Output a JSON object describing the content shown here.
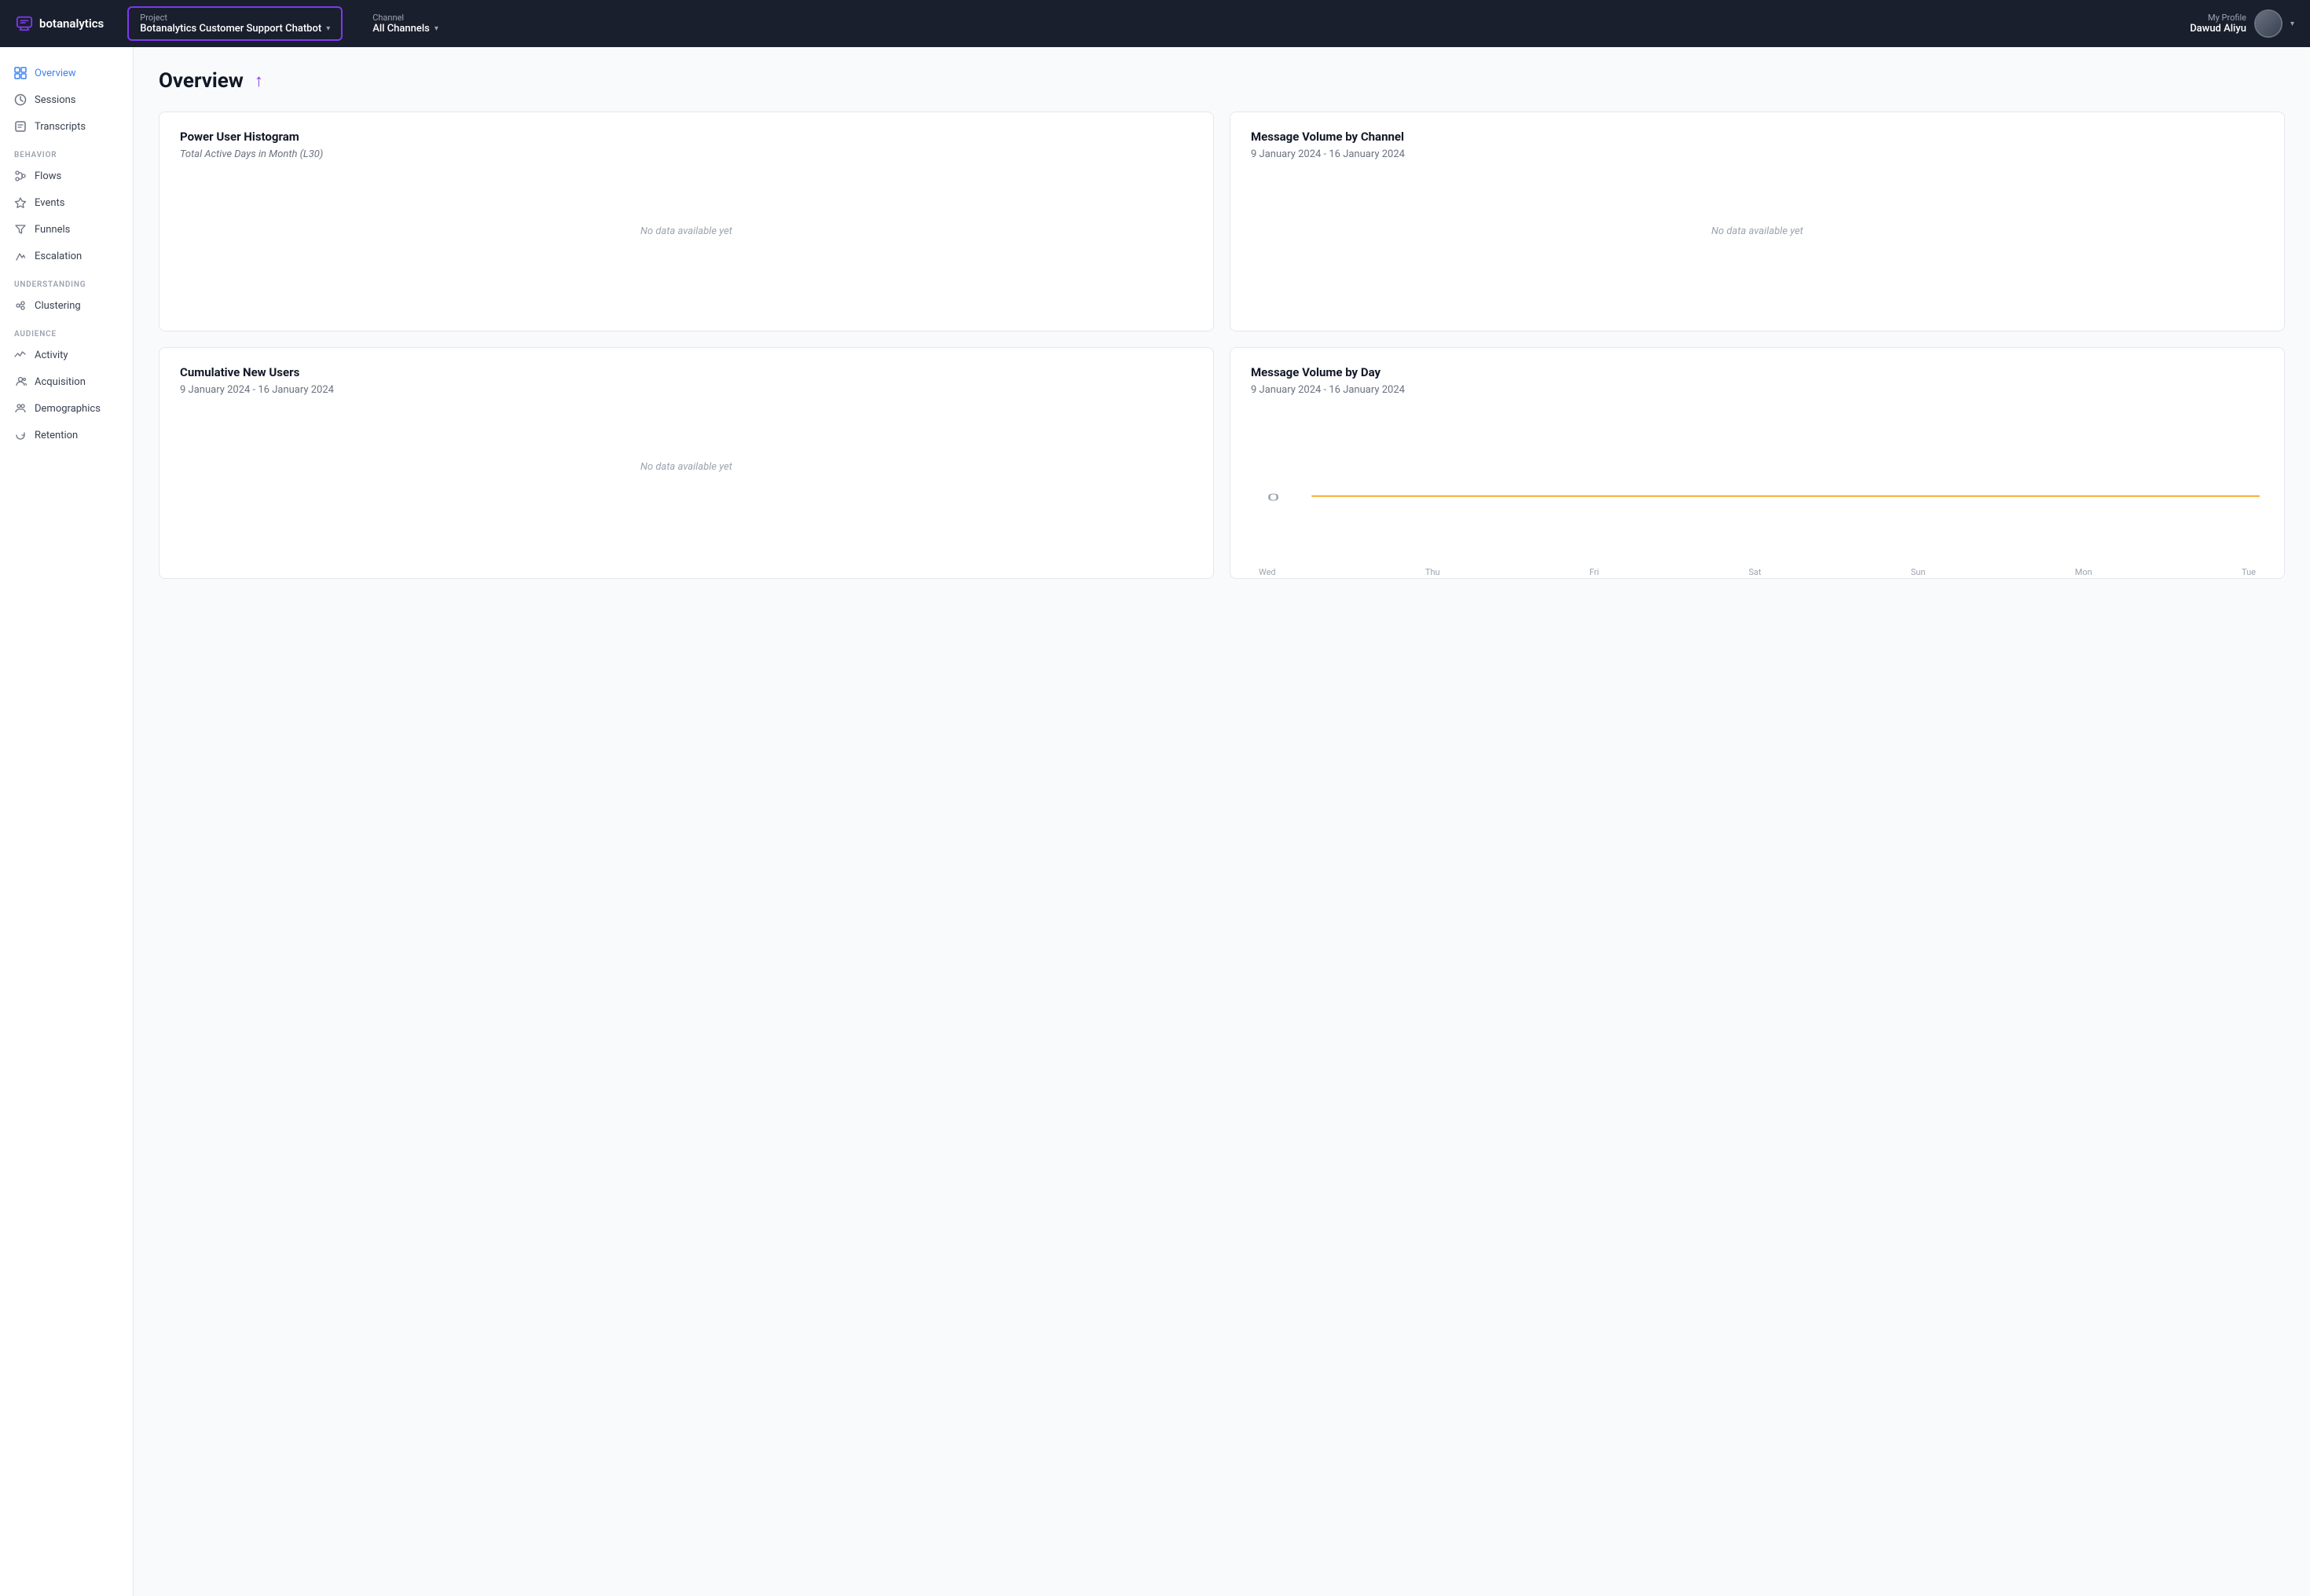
{
  "topnav": {
    "logo_text": "botanalytics",
    "project_label": "Project",
    "project_value": "Botanalytics Customer Support Chatbot",
    "channel_label": "Channel",
    "channel_value": "All Channels",
    "profile_label": "My Profile",
    "profile_name": "Dawud Aliyu"
  },
  "sidebar": {
    "items_main": [
      {
        "id": "overview",
        "label": "Overview",
        "active": true
      },
      {
        "id": "sessions",
        "label": "Sessions",
        "active": false
      },
      {
        "id": "transcripts",
        "label": "Transcripts",
        "active": false
      }
    ],
    "section_behavior": "BEHAVIOR",
    "items_behavior": [
      {
        "id": "flows",
        "label": "Flows"
      },
      {
        "id": "events",
        "label": "Events"
      },
      {
        "id": "funnels",
        "label": "Funnels"
      },
      {
        "id": "escalation",
        "label": "Escalation"
      }
    ],
    "section_understanding": "UNDERSTANDING",
    "items_understanding": [
      {
        "id": "clustering",
        "label": "Clustering"
      }
    ],
    "section_audience": "AUDIENCE",
    "items_audience": [
      {
        "id": "activity",
        "label": "Activity"
      },
      {
        "id": "acquisition",
        "label": "Acquisition"
      },
      {
        "id": "demographics",
        "label": "Demographics"
      },
      {
        "id": "retention",
        "label": "Retention"
      }
    ]
  },
  "page": {
    "title": "Overview"
  },
  "cards": [
    {
      "id": "power-user-histogram",
      "title": "Power User Histogram",
      "subtitle": "Total Active Days in Month (L30)",
      "has_data": false,
      "no_data_text": "No data available yet"
    },
    {
      "id": "message-volume-channel",
      "title": "Message Volume by Channel",
      "date_range": "9 January 2024 - 16 January 2024",
      "has_data": false,
      "no_data_text": "No data available yet"
    },
    {
      "id": "cumulative-new-users",
      "title": "Cumulative New Users",
      "date_range": "9 January 2024 - 16 January 2024",
      "has_data": false,
      "no_data_text": "No data available yet"
    },
    {
      "id": "message-volume-day",
      "title": "Message Volume by Day",
      "date_range": "9 January 2024 - 16 January 2024",
      "has_data": true,
      "chart_zero_label": "0",
      "x_labels": [
        "Wed",
        "Thu",
        "Fri",
        "Sat",
        "Sun",
        "Mon",
        "Tue"
      ]
    }
  ]
}
